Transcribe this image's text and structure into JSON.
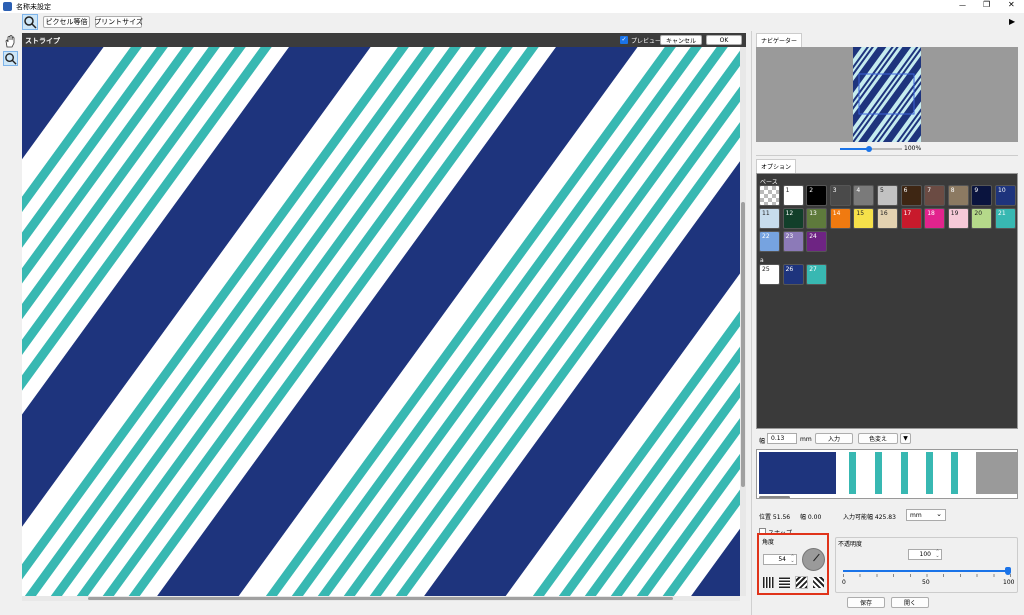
{
  "window": {
    "title": "名称未設定",
    "minimize": "—",
    "maximize": "❐",
    "close": "✕"
  },
  "toolbar": {
    "pixel_label": "ピクセル等倍",
    "print_label": "プリントサイズ",
    "play_icon": "▶"
  },
  "canvas_header": {
    "title": "ストライプ",
    "preview_label": "プレビュー",
    "cancel_label": "キャンセル",
    "ok_label": "OK"
  },
  "colors": {
    "navy": "#1e347d",
    "teal": "#38b8b2",
    "white": "#ffffff",
    "accent_red": "#e0331a"
  },
  "navigator": {
    "tab": "ナビゲーター",
    "zoom_text": "100%",
    "zoom_percent": 100
  },
  "options": {
    "tab": "オプション",
    "base_label": "ベース",
    "section_a_label": "a",
    "base_swatches": [
      {
        "n": "",
        "color": "checker"
      },
      {
        "n": "1",
        "color": "#ffffff"
      },
      {
        "n": "2",
        "color": "#000000"
      },
      {
        "n": "3",
        "color": "#4a4a4a"
      },
      {
        "n": "4",
        "color": "#7a7a7a"
      },
      {
        "n": "5",
        "color": "#c2c2c2"
      },
      {
        "n": "6",
        "color": "#3e2613"
      },
      {
        "n": "7",
        "color": "#6b4b43"
      },
      {
        "n": "8",
        "color": "#8c7a62"
      },
      {
        "n": "9",
        "color": "#0a143e"
      },
      {
        "n": "10",
        "color": "#1e347d"
      },
      {
        "n": "11",
        "color": "#c7dced"
      },
      {
        "n": "12",
        "color": "#123f2a"
      },
      {
        "n": "13",
        "color": "#5e7a3c"
      },
      {
        "n": "14",
        "color": "#f07a10"
      },
      {
        "n": "15",
        "color": "#f6e14a"
      },
      {
        "n": "16",
        "color": "#e3d2b0"
      },
      {
        "n": "17",
        "color": "#c81a2c"
      },
      {
        "n": "18",
        "color": "#e2238d"
      },
      {
        "n": "19",
        "color": "#f6c9d8"
      },
      {
        "n": "20",
        "color": "#b5d98a"
      },
      {
        "n": "21",
        "color": "#38b8b2"
      },
      {
        "n": "22",
        "color": "#76a3e0"
      },
      {
        "n": "23",
        "color": "#8c7ab8"
      },
      {
        "n": "24",
        "color": "#6e2483"
      }
    ],
    "a_swatches": [
      {
        "n": "25",
        "color": "#ffffff"
      },
      {
        "n": "26",
        "color": "#1e347d"
      },
      {
        "n": "27",
        "color": "#38b8b2"
      }
    ],
    "width_label": "幅",
    "width_value": "0.13",
    "unit_mm": "mm",
    "input_label": "入力",
    "recolor_label": "色変え",
    "dropdown_icon": "▼"
  },
  "position": {
    "pos_label": "位置 51.56",
    "width_label": "幅 0.00",
    "max_label": "入力可能幅 425.83",
    "unit_select": "mm",
    "chevron": "⌄"
  },
  "snap": {
    "label": "スナップ"
  },
  "angle": {
    "label": "角度",
    "value": "54"
  },
  "opacity": {
    "label": "不透明度",
    "value": "100",
    "tick_0": "0",
    "tick_50": "50",
    "tick_100": "100",
    "level": 1
  },
  "actions": {
    "save": "保存",
    "open": "開く"
  }
}
